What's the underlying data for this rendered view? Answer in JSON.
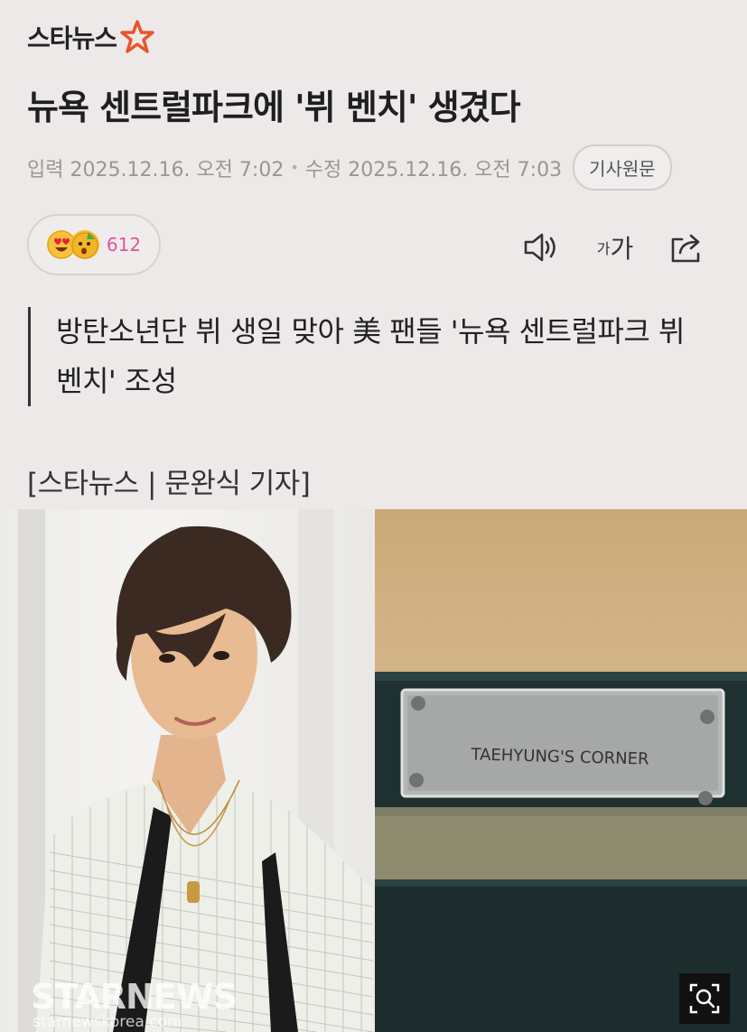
{
  "header": {
    "logo_text": "스타뉴스",
    "accent_color": "#e8552a"
  },
  "article": {
    "title": "뉴욕 센트럴파크에 '뷔 벤치' 생겼다",
    "input_label": "입력",
    "input_time": "2025.12.16. 오전 7:02",
    "modified_label": "수정",
    "modified_time": "2025.12.16. 오전 7:03",
    "original_button": "기사원문",
    "subtitle": "방탄소년단 뷔 생일 맞아 美 팬들 '뉴욕 센트럴파크 뷔 벤치' 조성",
    "byline": "[스타뉴스 | 문완식 기자]"
  },
  "reactions": {
    "count": "612",
    "icons": [
      "heart-eyes-emoji",
      "party-emoji"
    ]
  },
  "toolbar": {
    "font_small": "가",
    "font_big": "가",
    "icons": [
      "speaker-icon",
      "font-size-icon",
      "share-icon"
    ]
  },
  "photo": {
    "plaque_text": "TAEHYUNG'S CORNER",
    "watermark": "STARNEWS",
    "watermark_url": "starnewskorea.com",
    "zoom_icon": "zoom-icon"
  }
}
